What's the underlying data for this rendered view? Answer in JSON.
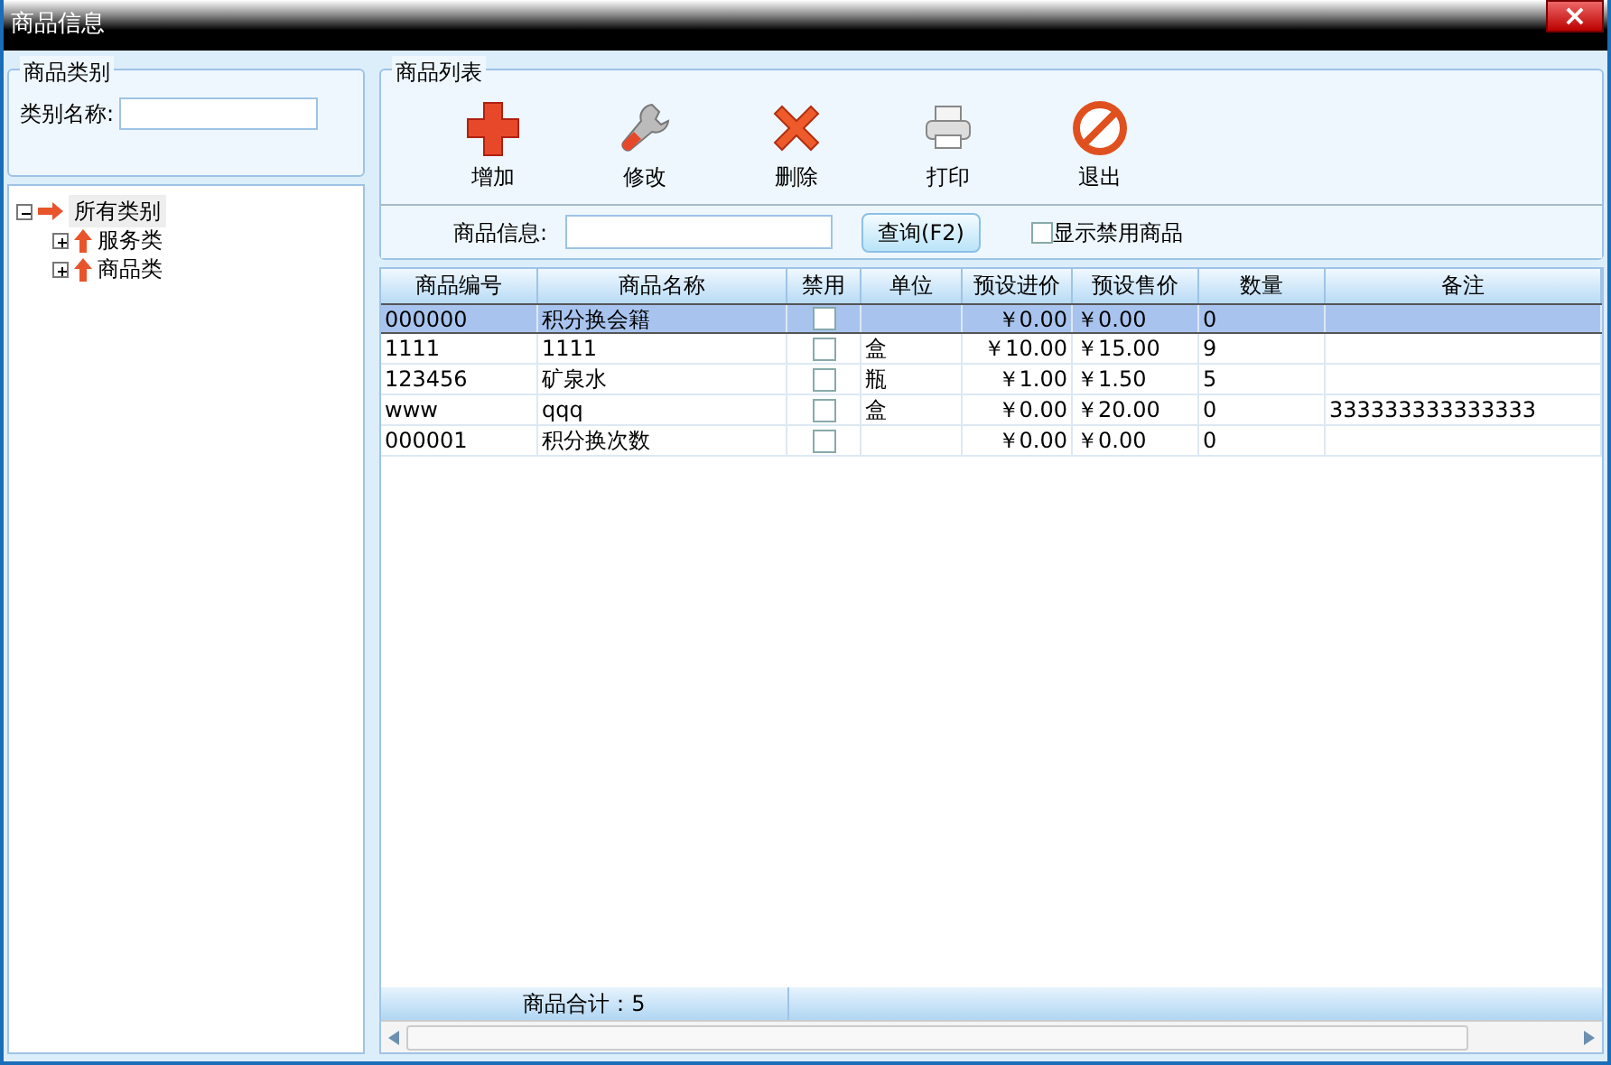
{
  "window": {
    "title": "商品信息",
    "close": "×"
  },
  "category_panel": {
    "title": "商品类别",
    "name_label": "类别名称:",
    "tree": [
      {
        "label": "所有类别",
        "expanded": true,
        "selected": true,
        "children": [
          {
            "label": "服务类",
            "expanded": false,
            "selected": false
          },
          {
            "label": "商品类",
            "expanded": false,
            "selected": false
          }
        ]
      }
    ]
  },
  "product_panel": {
    "title": "商品列表",
    "toolbar": [
      {
        "kind": "add",
        "label": "增加"
      },
      {
        "kind": "edit",
        "label": "修改"
      },
      {
        "kind": "delete",
        "label": "删除"
      },
      {
        "kind": "print",
        "label": "打印"
      },
      {
        "kind": "exit",
        "label": "退出"
      }
    ],
    "search": {
      "label": "商品信息:",
      "button": "查询(F2)",
      "show_disabled": {
        "label": "显示禁用商品",
        "checked": false
      }
    },
    "table": {
      "columns": [
        "商品编号",
        "商品名称",
        "禁用",
        "单位",
        "预设进价",
        "预设售价",
        "数量",
        "备注"
      ],
      "rows": [
        {
          "cells": [
            "000000",
            "积分换会籍",
            "",
            "",
            "￥0.00",
            "￥0.00",
            "0",
            ""
          ],
          "disabled": false,
          "selected": true
        },
        {
          "cells": [
            "1111",
            "1111",
            "",
            "盒",
            "￥10.00",
            "￥15.00",
            "9",
            ""
          ],
          "disabled": false,
          "selected": false
        },
        {
          "cells": [
            "123456",
            "矿泉水",
            "",
            "瓶",
            "￥1.00",
            "￥1.50",
            "5",
            ""
          ],
          "disabled": false,
          "selected": false
        },
        {
          "cells": [
            "www",
            "qqq",
            "",
            "盒",
            "￥0.00",
            "￥20.00",
            "0",
            "333333333333333"
          ],
          "disabled": false,
          "selected": false
        },
        {
          "cells": [
            "000001",
            "积分换次数",
            "",
            "",
            "￥0.00",
            "￥0.00",
            "0",
            ""
          ],
          "disabled": false,
          "selected": false
        }
      ],
      "footer": "商品合计：5"
    }
  }
}
